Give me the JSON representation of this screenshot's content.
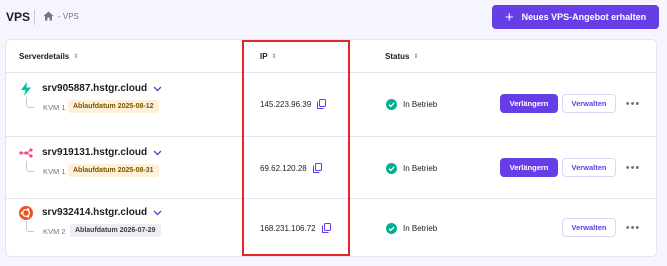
{
  "page": {
    "title": "VPS",
    "breadcrumb": "- VPS",
    "new_button": "Neues VPS-Angebot erhalten"
  },
  "colors": {
    "accent": "#673de6",
    "status_ok": "#00b090",
    "highlight": "#e6252b",
    "expiry_badge": "#fff1d9"
  },
  "table": {
    "headers": {
      "server": "Serverdetails",
      "ip": "IP",
      "status": "Status"
    },
    "rows": [
      {
        "os_icon": "almalinux-bolt-icon",
        "name": "srv905887.hstgr.cloud",
        "plan": "KVM 1",
        "expiry": "Ablaufdatum 2025-08-12",
        "ip": "145.223.96.39",
        "status": "In Betrieb",
        "renew": "Verlängern",
        "manage": "Verwalten"
      },
      {
        "os_icon": "n8n-icon",
        "name": "srv919131.hstgr.cloud",
        "plan": "KVM 1",
        "expiry": "Ablaufdatum 2025-08-31",
        "ip": "69.62.120.28",
        "status": "In Betrieb",
        "renew": "Verlängern",
        "manage": "Verwalten"
      },
      {
        "os_icon": "ubuntu-icon",
        "name": "srv932414.hstgr.cloud",
        "plan": "KVM 2",
        "expiry": "Ablaufdatum 2026-07-29",
        "ip": "168.231.106.72",
        "status": "In Betrieb",
        "manage": "Verwalten"
      }
    ]
  }
}
